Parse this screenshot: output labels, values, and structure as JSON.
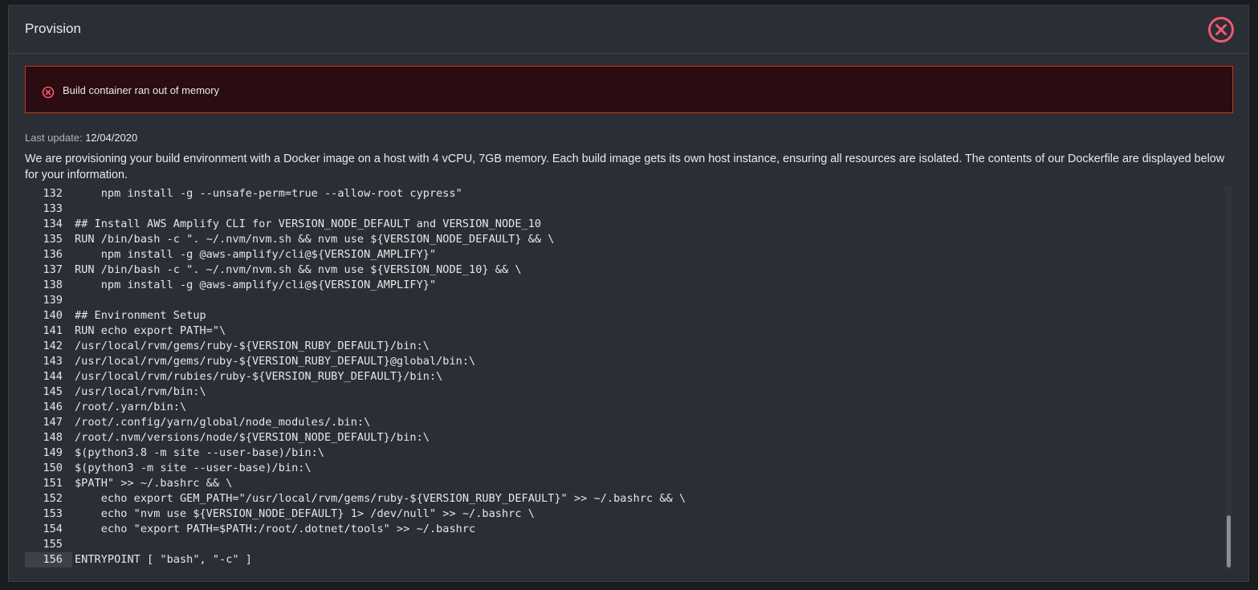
{
  "modal": {
    "title": "Provision"
  },
  "alert": {
    "message": "Build container ran out of memory"
  },
  "status": {
    "last_update_label": "Last update:",
    "last_update_value": "12/04/2020"
  },
  "description": "We are provisioning your build environment with a Docker image on a host with 4 vCPU, 7GB memory. Each build image gets its own host instance, ensuring all resources are isolated. The contents of our Dockerfile are displayed below for your information.",
  "code": {
    "lines": [
      {
        "num": "132",
        "text": "    npm install -g --unsafe-perm=true --allow-root cypress\""
      },
      {
        "num": "133",
        "text": ""
      },
      {
        "num": "134",
        "text": "## Install AWS Amplify CLI for VERSION_NODE_DEFAULT and VERSION_NODE_10"
      },
      {
        "num": "135",
        "text": "RUN /bin/bash -c \". ~/.nvm/nvm.sh && nvm use ${VERSION_NODE_DEFAULT} && \\"
      },
      {
        "num": "136",
        "text": "    npm install -g @aws-amplify/cli@${VERSION_AMPLIFY}\""
      },
      {
        "num": "137",
        "text": "RUN /bin/bash -c \". ~/.nvm/nvm.sh && nvm use ${VERSION_NODE_10} && \\"
      },
      {
        "num": "138",
        "text": "    npm install -g @aws-amplify/cli@${VERSION_AMPLIFY}\""
      },
      {
        "num": "139",
        "text": ""
      },
      {
        "num": "140",
        "text": "## Environment Setup"
      },
      {
        "num": "141",
        "text": "RUN echo export PATH=\"\\"
      },
      {
        "num": "142",
        "text": "/usr/local/rvm/gems/ruby-${VERSION_RUBY_DEFAULT}/bin:\\"
      },
      {
        "num": "143",
        "text": "/usr/local/rvm/gems/ruby-${VERSION_RUBY_DEFAULT}@global/bin:\\"
      },
      {
        "num": "144",
        "text": "/usr/local/rvm/rubies/ruby-${VERSION_RUBY_DEFAULT}/bin:\\"
      },
      {
        "num": "145",
        "text": "/usr/local/rvm/bin:\\"
      },
      {
        "num": "146",
        "text": "/root/.yarn/bin:\\"
      },
      {
        "num": "147",
        "text": "/root/.config/yarn/global/node_modules/.bin:\\"
      },
      {
        "num": "148",
        "text": "/root/.nvm/versions/node/${VERSION_NODE_DEFAULT}/bin:\\"
      },
      {
        "num": "149",
        "text": "$(python3.8 -m site --user-base)/bin:\\"
      },
      {
        "num": "150",
        "text": "$(python3 -m site --user-base)/bin:\\"
      },
      {
        "num": "151",
        "text": "$PATH\" >> ~/.bashrc && \\"
      },
      {
        "num": "152",
        "text": "    echo export GEM_PATH=\"/usr/local/rvm/gems/ruby-${VERSION_RUBY_DEFAULT}\" >> ~/.bashrc && \\"
      },
      {
        "num": "153",
        "text": "    echo \"nvm use ${VERSION_NODE_DEFAULT} 1> /dev/null\" >> ~/.bashrc \\"
      },
      {
        "num": "154",
        "text": "    echo \"export PATH=$PATH:/root/.dotnet/tools\" >> ~/.bashrc"
      },
      {
        "num": "155",
        "text": ""
      },
      {
        "num": "156",
        "text": "ENTRYPOINT [ \"bash\", \"-c\" ]"
      }
    ]
  },
  "colors": {
    "alert_border": "#d13212",
    "alert_bg": "#2b0c12",
    "close_icon": "#ef5b6f",
    "panel_bg": "#2a2e35"
  },
  "icons": {
    "close": "close-circle-icon",
    "alert": "error-circle-icon"
  }
}
